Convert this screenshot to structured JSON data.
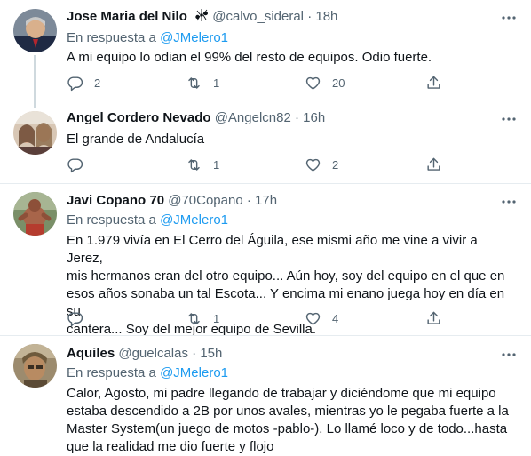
{
  "tweets": [
    {
      "name": "Jose Maria del Nilo",
      "handle": "@calvo_sideral",
      "time": "18h",
      "reply_label": "En respuesta a",
      "reply_mention": "@JMelero1",
      "text": "A mi equipo lo odian el 99% del resto de equipos. Odio fuerte.",
      "replies": "2",
      "retweets": "1",
      "likes": "20"
    },
    {
      "name": "Angel Cordero Nevado",
      "handle": "@Angelcn82",
      "time": "16h",
      "text": "El grande de Andalucía",
      "replies": "",
      "retweets": "1",
      "likes": "2"
    },
    {
      "name": "Javi Copano 70",
      "handle": "@70Copano",
      "time": "17h",
      "reply_label": "En respuesta a",
      "reply_mention": "@JMelero1",
      "text_lines": [
        "En 1.979 vivía en El Cerro del Águila, ese mismi año me vine a vivir a Jerez,",
        "mis hermanos eran del otro equipo... Aún hoy, soy del equipo en el que en",
        "esos años sonaba un tal Escota... Y encima mi enano juega hoy en día en su",
        "cantera... Soy del mejor equipo de Sevilla."
      ],
      "replies": "",
      "retweets": "1",
      "likes": "4"
    },
    {
      "name": "Aquiles",
      "handle": "@guelcalas",
      "time": "15h",
      "reply_label": "En respuesta a",
      "reply_mention": "@JMelero1",
      "text_lines": [
        "Calor, Agosto, mi padre llegando de trabajar y diciéndome que mi equipo",
        "estaba descendido a 2B por unos avales, mientras yo le pegaba fuerte a la",
        "Master System(un juego de motos -pablo-). Lo llamé loco y de todo...hasta",
        "que la realidad me dio fuerte y flojo"
      ]
    }
  ],
  "separator": "·",
  "colors": {
    "text": "#0f1419",
    "muted": "#536471",
    "link": "#1d9bf0",
    "divider": "#e6ecf0"
  }
}
